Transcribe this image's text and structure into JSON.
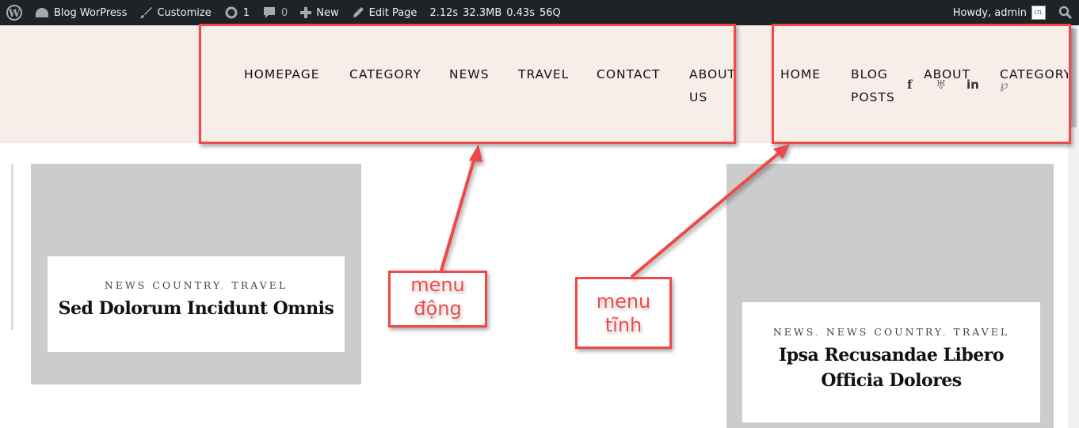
{
  "adminbar": {
    "site": "Blog WorPress",
    "customize": "Customize",
    "updates": "1",
    "comments": "0",
    "new": "New",
    "edit": "Edit Page",
    "stats": [
      "2.12s",
      "32.3MB",
      "0.43s",
      "56Q"
    ],
    "howdy": "Howdy, admin",
    "avatar": "LTL"
  },
  "dynamic_menu": [
    "HOMEPAGE",
    "CATEGORY",
    "NEWS",
    "TRAVEL",
    "CONTACT",
    "ABOUT",
    "US"
  ],
  "static_menu": [
    "HOME",
    "BLOG",
    "POSTS",
    "ABOUT",
    "CATEGORY"
  ],
  "social": [
    "facebook-icon",
    "twitter-icon",
    "linkedin-icon",
    "pinterest-icon"
  ],
  "posts": [
    {
      "cats": [
        "NEWS COUNTRY",
        "TRAVEL"
      ],
      "title": "Sed Dolorum Incidunt Omnis"
    },
    {
      "cats": [
        "NEWS",
        "NEWS COUNTRY",
        "TRAVEL"
      ],
      "title_lines": [
        "Ipsa Recusandae Libero",
        "Officia Dolores"
      ]
    }
  ],
  "annotations": {
    "dynamic": [
      "menu",
      "động"
    ],
    "static": [
      "menu",
      "tĩnh"
    ],
    "color": "#f04848"
  },
  "colors": {
    "adminbar": "#1d2327",
    "header": "#f7eee9",
    "card": "#cccccc"
  }
}
